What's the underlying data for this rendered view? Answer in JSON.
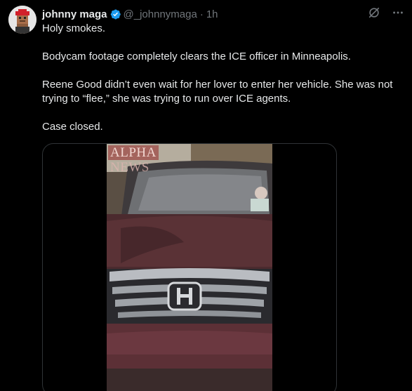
{
  "tweet": {
    "author_name": "johnny maga",
    "handle": "@_johnnymaga",
    "separator": "·",
    "time": "1h",
    "paragraphs": [
      "Holy smokes.",
      "Bodycam footage completely clears the ICE officer in Minneapolis.",
      "Reene Good didn’t even wait for her lover to enter her vehicle. She was not trying to “flee,” she was trying to run over ICE agents.",
      "Case closed."
    ]
  },
  "media": {
    "watermark_line1": "ALPHA",
    "watermark_line2": "NEWS"
  },
  "icons": {
    "verified": "verified-badge-icon",
    "grok": "grok-icon",
    "more": "more-options-icon"
  },
  "colors": {
    "verified_blue": "#1d9bf0",
    "text": "#e7e9ea",
    "muted": "#71767b",
    "background": "#000000"
  }
}
